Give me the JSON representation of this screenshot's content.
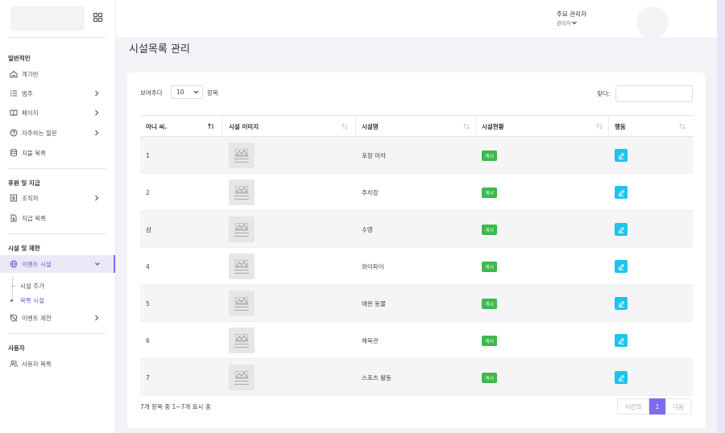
{
  "sidebar": {
    "sections": [
      {
        "heading": "일반적인"
      },
      {
        "heading": "후원 및 지급"
      },
      {
        "heading": "시설 및 제한"
      },
      {
        "heading": "사용자"
      }
    ],
    "items": [
      {
        "label": "계기반",
        "icon": "home-icon"
      },
      {
        "label": "범주",
        "icon": "list-icon"
      },
      {
        "label": "페이지",
        "icon": "book-icon"
      },
      {
        "label": "자주하는 질문",
        "icon": "question-circle-icon"
      },
      {
        "label": "지불 목록",
        "icon": "database-icon"
      },
      {
        "label": "조직자",
        "icon": "id-badge-icon"
      },
      {
        "label": "지급 목록",
        "icon": "file-dollar-icon"
      },
      {
        "label": "이벤트 시설",
        "icon": "globe-icon"
      },
      {
        "label": "이벤트 제한",
        "icon": "shield-off-icon"
      },
      {
        "label": "사용자 목록",
        "icon": "users-icon"
      }
    ],
    "subitems": [
      {
        "label": "시설 추가"
      },
      {
        "label": "목록 시설"
      }
    ]
  },
  "header": {
    "user_name": "주요 관리자",
    "user_role": "관리자"
  },
  "page": {
    "title": "시설목록 관리"
  },
  "table_controls": {
    "show_label": "보여주다",
    "page_length": "10",
    "entries_label": "항목",
    "search_label": "찾다:"
  },
  "table": {
    "columns": [
      "아니 씨.",
      "시설 이미지",
      "시설명",
      "시설현황",
      "행동"
    ],
    "rows": [
      {
        "no": "1",
        "name": "포장 마차",
        "status": "게시"
      },
      {
        "no": "2",
        "name": "주차장",
        "status": "게시"
      },
      {
        "no": "삼",
        "name": "수영",
        "status": "게시"
      },
      {
        "no": "4",
        "name": "와이파이",
        "status": "게시"
      },
      {
        "no": "5",
        "name": "애완 동물",
        "status": "게시"
      },
      {
        "no": "6",
        "name": "체육관",
        "status": "게시"
      },
      {
        "no": "7",
        "name": "스포츠 활동",
        "status": "게시"
      }
    ]
  },
  "footer": {
    "info": "7개 항목 중 1~7개 표시 중",
    "prev": "이전의",
    "current_page": "1",
    "next": "다음"
  },
  "colors": {
    "accent": "#7b6cf0",
    "badge_green": "#3cb94a",
    "edit_cyan": "#1cc4ee"
  }
}
